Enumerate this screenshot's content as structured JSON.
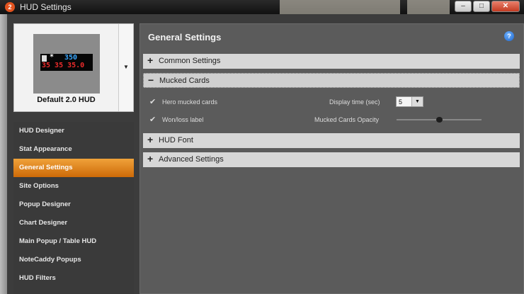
{
  "window": {
    "title": "HUD Settings",
    "icon_text": "2",
    "minimize": "–",
    "maximize": "□",
    "close": "✕"
  },
  "preview": {
    "label": "Default 2.0 HUD",
    "stat_top": "350",
    "stat_bottom": "35 35 35.0",
    "star": "*",
    "dropdown_icon": "triangle-down-icon"
  },
  "sidebar": {
    "items": [
      {
        "label": "HUD Designer"
      },
      {
        "label": "Stat Appearance"
      },
      {
        "label": "General Settings"
      },
      {
        "label": "Site Options"
      },
      {
        "label": "Popup Designer"
      },
      {
        "label": "Chart Designer"
      },
      {
        "label": "Main Popup / Table HUD"
      },
      {
        "label": "NoteCaddy Popups"
      },
      {
        "label": "HUD Filters"
      }
    ],
    "active": "General Settings"
  },
  "main": {
    "title": "General Settings",
    "help_icon": "?",
    "sections": {
      "common": {
        "label": "Common Settings",
        "sign": "+"
      },
      "mucked": {
        "label": "Mucked Cards",
        "sign": "−"
      },
      "font": {
        "label": "HUD Font",
        "sign": "+"
      },
      "advanced": {
        "label": "Advanced Settings",
        "sign": "+"
      }
    },
    "mucked_options": {
      "hero_mucked_label": "Hero mucked cards",
      "hero_mucked_checked": true,
      "won_loss_label": "Won/loss label",
      "won_loss_checked": true,
      "display_time_label": "Display time (sec)",
      "display_time_value": "5",
      "opacity_label": "Mucked Cards Opacity",
      "opacity_fraction": 0.5
    }
  }
}
